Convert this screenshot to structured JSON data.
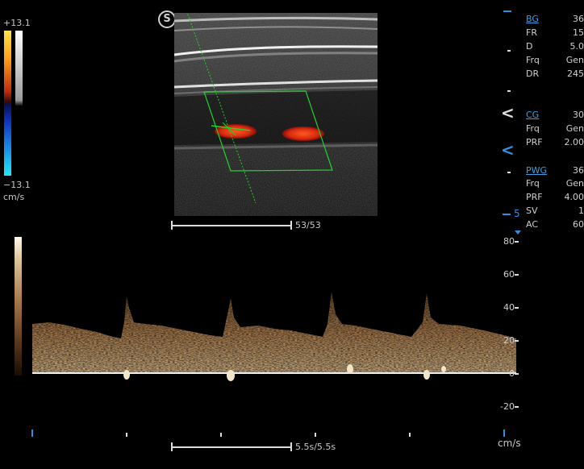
{
  "color_scale": {
    "max": "+13.1",
    "min": "−13.1",
    "unit": "cm/s"
  },
  "logo_text": "S",
  "bmode": {
    "depth_counter": "53/53"
  },
  "params": {
    "bg": {
      "name": "BG",
      "value": "36"
    },
    "fr": {
      "name": "FR",
      "value": "15"
    },
    "d": {
      "name": "D",
      "value": "5.0"
    },
    "frq1": {
      "name": "Frq",
      "value": "Gen"
    },
    "dr": {
      "name": "DR",
      "value": "245"
    },
    "cg": {
      "name": "CG",
      "value": "30"
    },
    "frq2": {
      "name": "Frq",
      "value": "Gen"
    },
    "prf1": {
      "name": "PRF",
      "value": "2.00"
    },
    "pwg": {
      "name": "PWG",
      "value": "36"
    },
    "frq3": {
      "name": "Frq",
      "value": "Gen"
    },
    "prf2": {
      "name": "PRF",
      "value": "4.00"
    },
    "sv": {
      "name": "SV",
      "value": "1"
    },
    "ac": {
      "name": "AC",
      "value": "60"
    }
  },
  "depth_marker": "5",
  "spectral": {
    "scale_labels": [
      "80",
      "60",
      "40",
      "20",
      "0",
      "-20"
    ],
    "unit": "cm/s",
    "time_counter": "5.5s/5.5s"
  },
  "colors": {
    "accent_blue": "#2f8fe0",
    "link_blue": "#3aa0e0",
    "roi_green": "#22d22a",
    "flow_red": "#e03010",
    "spectral_brown": "#b08050"
  }
}
